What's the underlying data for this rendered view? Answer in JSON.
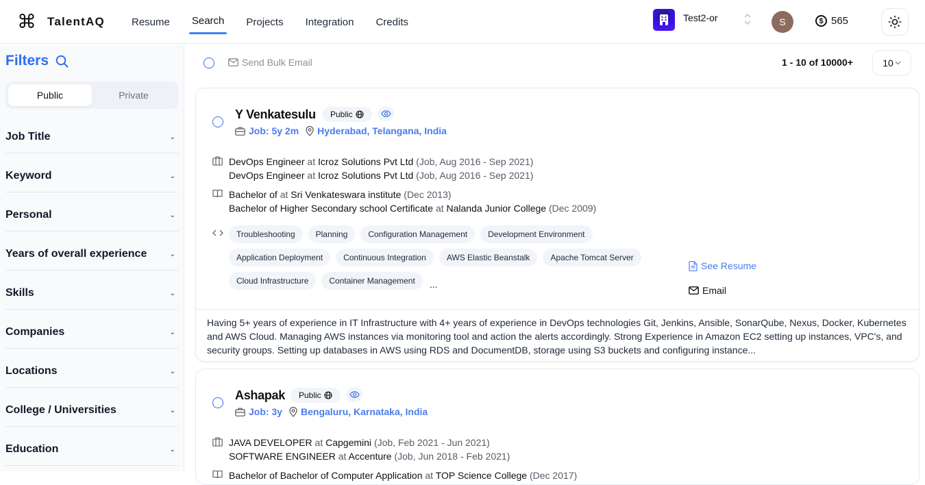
{
  "app": {
    "logo_glyph": "⌘",
    "name": "TalentAQ"
  },
  "nav": {
    "items": [
      {
        "label": "Resume",
        "active": false
      },
      {
        "label": "Search",
        "active": true
      },
      {
        "label": "Projects",
        "active": false
      },
      {
        "label": "Integration",
        "active": false
      },
      {
        "label": "Credits",
        "active": false
      }
    ]
  },
  "header": {
    "org_name": "Test2-or",
    "avatar_initial": "S",
    "credits_symbol": "$",
    "credits": "565",
    "theme_icon": "sun-icon"
  },
  "sidebar": {
    "title": "Filters",
    "toggle": [
      {
        "label": "Public",
        "active": true
      },
      {
        "label": "Private",
        "active": false
      }
    ],
    "filters": [
      "Job Title",
      "Keyword",
      "Personal",
      "Years of overall experience",
      "Skills",
      "Companies",
      "Locations",
      "College / Universities",
      "Education"
    ],
    "chevron_glyph": "⌄"
  },
  "toolbar": {
    "bulk_email_label": "Send Bulk Email",
    "pagination": "1 - 10 of 10000+",
    "page_size": "10",
    "page_size_caret": "⌄"
  },
  "candidates": [
    {
      "name": "Y Venkatesulu",
      "visibility": "Public",
      "globe_glyph": "🌐",
      "job_experience": "Job: 5y 2m",
      "location": "Hyderabad, Telangana, India",
      "jobs": [
        {
          "title": "DevOps Engineer",
          "at": "at",
          "company": "Icroz Solutions Pvt Ltd",
          "detail": "(Job, Aug 2016 - Sep 2021)"
        },
        {
          "title": "DevOps Engineer",
          "at": "at",
          "company": "Icroz Solutions Pvt Ltd",
          "detail": "(Job, Aug 2016 - Sep 2021)"
        }
      ],
      "education": [
        {
          "degree": "Bachelor of",
          "at": "at",
          "school": "Sri Venkateswara institute",
          "detail": "(Dec 2013)"
        },
        {
          "degree": "Bachelor of Higher Secondary school Certificate",
          "at": "at",
          "school": "Nalanda Junior College",
          "detail": "(Dec 2009)"
        }
      ],
      "skills": [
        "Troubleshooting",
        "Planning",
        "Configuration Management",
        "Development Environment",
        "Application Deployment",
        "Continuous Integration",
        "AWS Elastic Beanstalk",
        "Apache Tomcat Server",
        "Cloud Infrastructure",
        "Container Management"
      ],
      "more_skills": "...",
      "see_resume_label": "See Resume",
      "email_label": "Email",
      "summary": "Having 5+ years of experience in IT Infrastructure with 4+ years of experience in DevOps technologies Git, Jenkins, Ansible, SonarQube, Nexus, Docker, Kubernetes and AWS Cloud. Managing AWS instances via monitoring tool and action the alerts accordingly. Strong Experience in Amazon EC2 setting up instances, VPC's, and security groups. Setting up databases in AWS using RDS and DocumentDB, storage using S3 buckets and configuring instance..."
    },
    {
      "name": "Ashapak",
      "visibility": "Public",
      "globe_glyph": "🌐",
      "job_experience": "Job: 3y",
      "location": "Bengaluru, Karnataka, India",
      "jobs": [
        {
          "title": "JAVA DEVELOPER",
          "at": "at",
          "company": "Capgemini",
          "detail": "(Job, Feb 2021 - Jun 2021)"
        },
        {
          "title": "SOFTWARE ENGINEER",
          "at": "at",
          "company": "Accenture",
          "detail": "(Job, Jun 2018 - Feb 2021)"
        }
      ],
      "education": [
        {
          "degree": "Bachelor of Bachelor of Computer Application",
          "at": "at",
          "school": "TOP Science College",
          "detail": "(Dec 2017)"
        }
      ]
    }
  ]
}
